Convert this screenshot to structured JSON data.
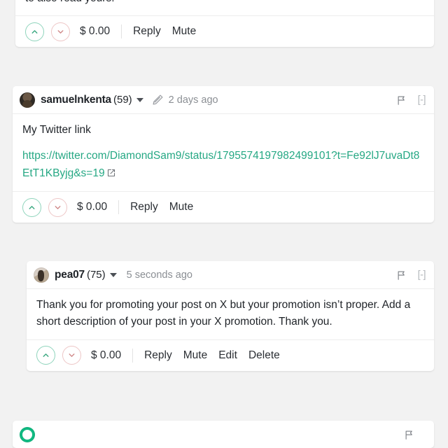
{
  "theme": {
    "page_background": "#f2f2f2",
    "card_background": "#ffffff",
    "link_color": "#26a884",
    "upvote_color": "#3aa880",
    "downvote_color": "#d08a8a",
    "text_color": "#1f2328",
    "muted_text_color": "#8b8f94"
  },
  "icons": {
    "caret_down": "chevron-down-icon",
    "edited": "pencil-icon",
    "flag": "flag-icon",
    "collapse": "[-]",
    "upvote": "chevron-up-icon",
    "downvote": "chevron-down-icon",
    "external_link": "external-link-icon"
  },
  "comments": [
    {
      "id": "comment-partial-top",
      "body_tail": "to also read yours.",
      "actions": {
        "amount": "$ 0.00",
        "items": [
          "Reply",
          "Mute"
        ]
      }
    },
    {
      "id": "comment-samuelnkenta",
      "author": "samuelnkenta",
      "karma": "(59)",
      "edited": true,
      "timestamp": "2 days ago",
      "collapse_label": "[-]",
      "body_text": "My Twitter link",
      "link_text": "https://twitter.com/DiamondSam9/status/1795574197982499101?t=Fe92lJ7uvaDt8EtT1KByjg&s=19",
      "actions": {
        "amount": "$ 0.00",
        "items": [
          "Reply",
          "Mute"
        ]
      }
    },
    {
      "id": "comment-pea07",
      "author": "pea07",
      "karma": "(75)",
      "edited": false,
      "timestamp": "5 seconds ago",
      "collapse_label": "[-]",
      "body_text": "Thank you for promoting your post on X but your promotion isn’t proper. Add a short description of your post in your X promotion. Thank you.",
      "actions": {
        "amount": "$ 0.00",
        "items": [
          "Reply",
          "Mute",
          "Edit",
          "Delete"
        ]
      }
    },
    {
      "id": "comment-partial-bottom",
      "author": "",
      "karma": "",
      "timestamp": ""
    }
  ]
}
